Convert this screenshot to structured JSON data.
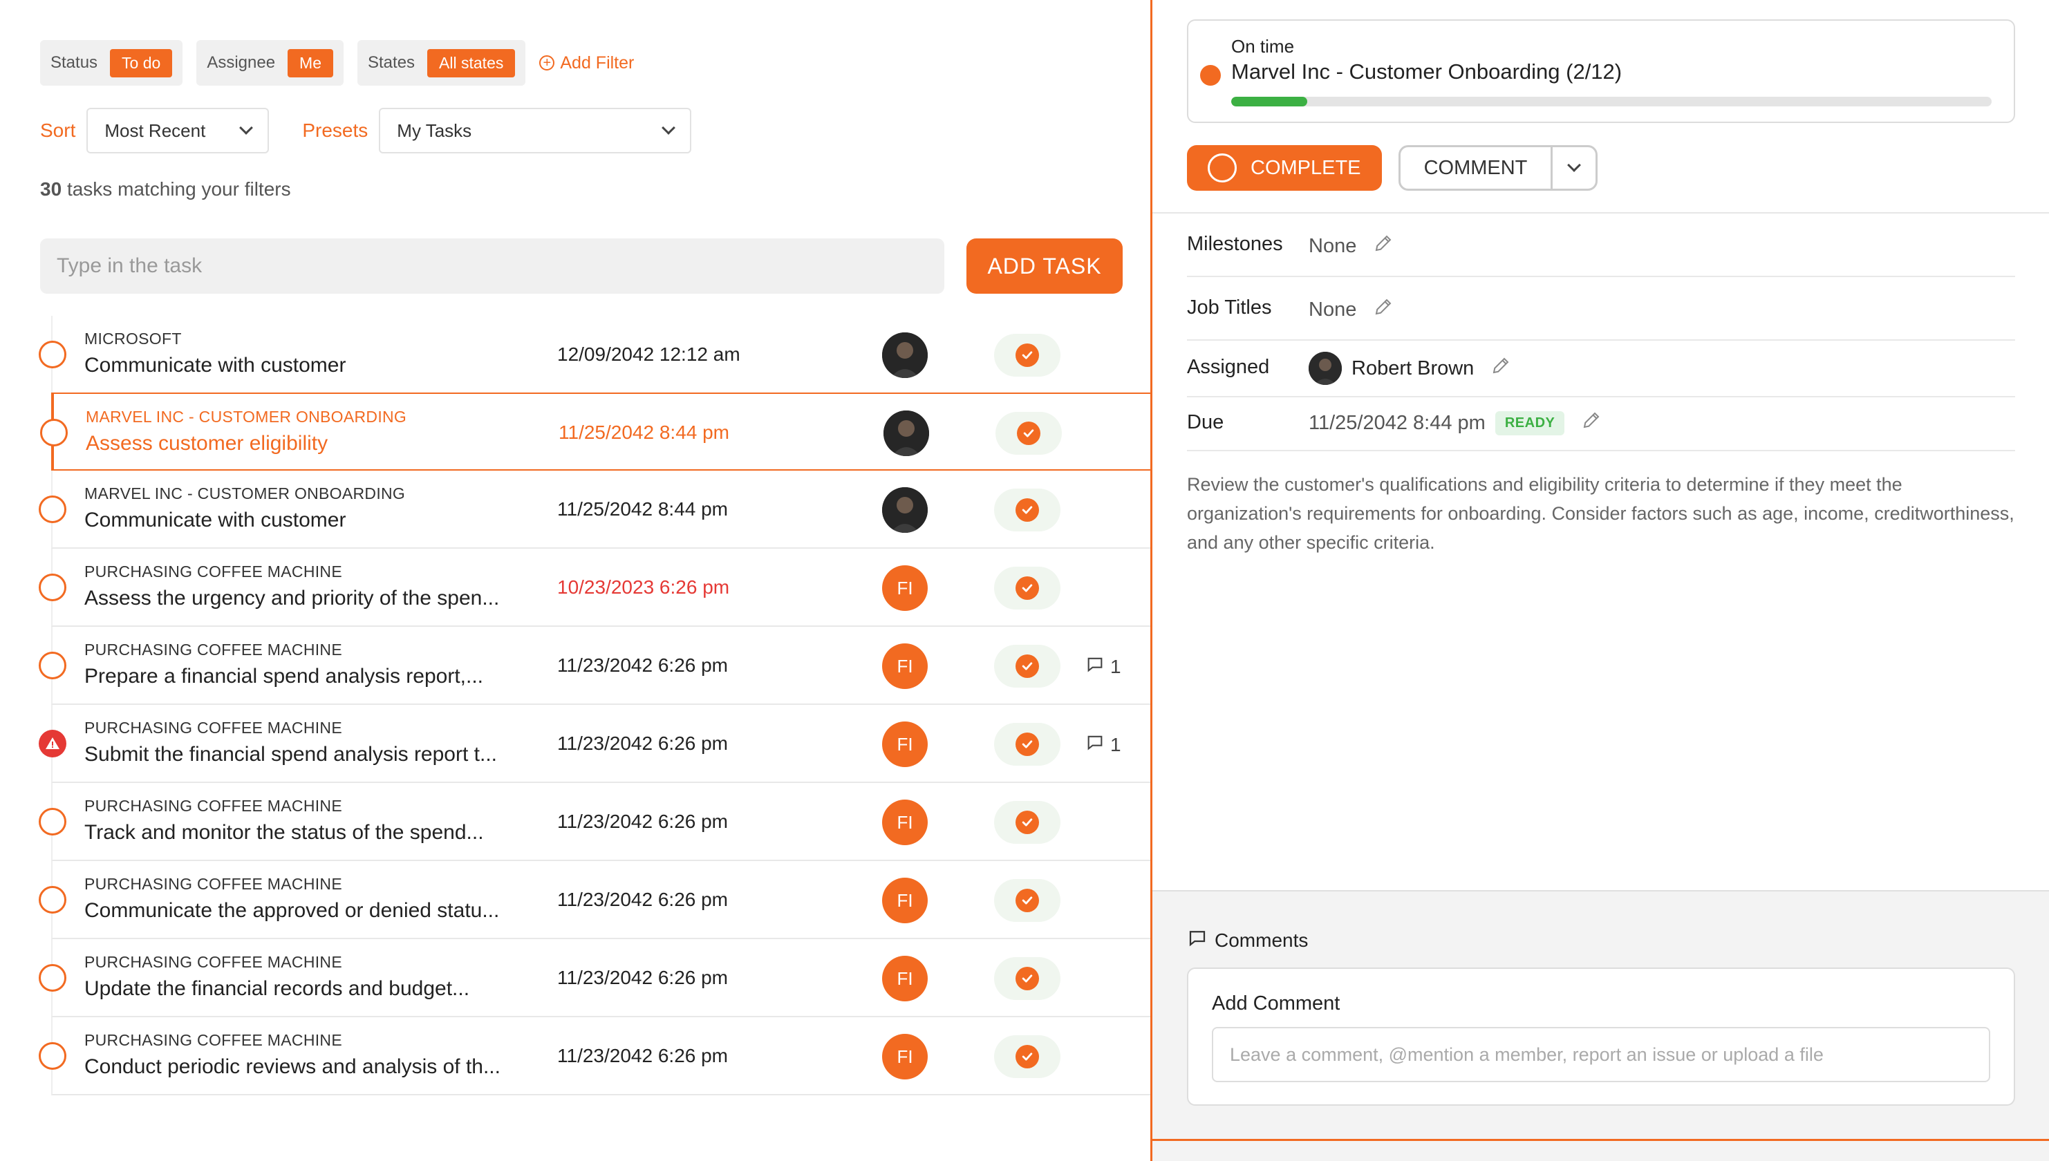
{
  "colors": {
    "accent": "#f26a21",
    "success": "#3cb043",
    "danger": "#e53935"
  },
  "filters": [
    {
      "label": "Status",
      "value": "To do"
    },
    {
      "label": "Assignee",
      "value": "Me"
    },
    {
      "label": "States",
      "value": "All states"
    }
  ],
  "add_filter": "Add Filter",
  "sort": {
    "label": "Sort",
    "value": "Most Recent"
  },
  "presets": {
    "label": "Presets",
    "value": "My Tasks"
  },
  "count": {
    "number": "30",
    "text": "tasks matching your filters"
  },
  "task_input": {
    "placeholder": "Type in the task"
  },
  "add_task_label": "ADD TASK",
  "tasks": [
    {
      "project": "MICROSOFT",
      "title": "Communicate with customer",
      "date": "12/09/2042 12:12 am",
      "assignee": "photo",
      "status": "todo",
      "comments": ""
    },
    {
      "project": "MARVEL INC - CUSTOMER ONBOARDING",
      "title": "Assess customer eligibility",
      "date": "11/25/2042 8:44 pm",
      "assignee": "photo",
      "status": "todo",
      "comments": "",
      "selected": true
    },
    {
      "project": "MARVEL INC - CUSTOMER ONBOARDING",
      "title": "Communicate with customer",
      "date": "11/25/2042 8:44 pm",
      "assignee": "photo",
      "status": "todo",
      "comments": ""
    },
    {
      "project": "PURCHASING COFFEE MACHINE",
      "title": "Assess the urgency and priority of the spen...",
      "date": "10/23/2023 6:26 pm",
      "assignee": "FI",
      "status": "todo",
      "comments": "",
      "late": true
    },
    {
      "project": "PURCHASING COFFEE MACHINE",
      "title": "Prepare a financial spend analysis report,...",
      "date": "11/23/2042 6:26 pm",
      "assignee": "FI",
      "status": "todo",
      "comments": "1"
    },
    {
      "project": "PURCHASING COFFEE MACHINE",
      "title": "Submit the financial spend analysis report t...",
      "date": "11/23/2042 6:26 pm",
      "assignee": "FI",
      "status": "issue",
      "comments": "1"
    },
    {
      "project": "PURCHASING COFFEE MACHINE",
      "title": "Track and monitor the status of the spend...",
      "date": "11/23/2042 6:26 pm",
      "assignee": "FI",
      "status": "todo",
      "comments": ""
    },
    {
      "project": "PURCHASING COFFEE MACHINE",
      "title": "Communicate the approved or denied statu...",
      "date": "11/23/2042 6:26 pm",
      "assignee": "FI",
      "status": "todo",
      "comments": ""
    },
    {
      "project": "PURCHASING COFFEE MACHINE",
      "title": "Update the financial records and budget...",
      "date": "11/23/2042 6:26 pm",
      "assignee": "FI",
      "status": "todo",
      "comments": ""
    },
    {
      "project": "PURCHASING COFFEE MACHINE",
      "title": "Conduct periodic reviews and analysis of th...",
      "date": "11/23/2042 6:26 pm",
      "assignee": "FI",
      "status": "todo",
      "comments": ""
    }
  ],
  "detail": {
    "progress": {
      "status": "On time",
      "name": "Marvel Inc - Customer Onboarding (2/12)",
      "fraction": 0.1
    },
    "complete_label": "COMPLETE",
    "comment_label": "COMMENT",
    "meta": {
      "milestones": {
        "label": "Milestones",
        "value": "None"
      },
      "job_titles": {
        "label": "Job Titles",
        "value": "None"
      },
      "assigned": {
        "label": "Assigned",
        "value": "Robert Brown"
      },
      "due": {
        "label": "Due",
        "value": "11/25/2042 8:44 pm",
        "badge": "READY"
      }
    },
    "description": "Review the customer's qualifications and eligibility criteria to determine if they meet the organization's requirements for onboarding. Consider factors such as age, income, creditworthiness, and any other specific criteria."
  },
  "comments": {
    "heading": "Comments",
    "add_title": "Add Comment",
    "placeholder": "Leave a comment, @mention a member, report an issue or upload a file"
  },
  "icons": [
    "plus-circle-icon",
    "chevron-down-icon",
    "check-icon",
    "warning-icon",
    "comment-icon",
    "pencil-icon"
  ]
}
